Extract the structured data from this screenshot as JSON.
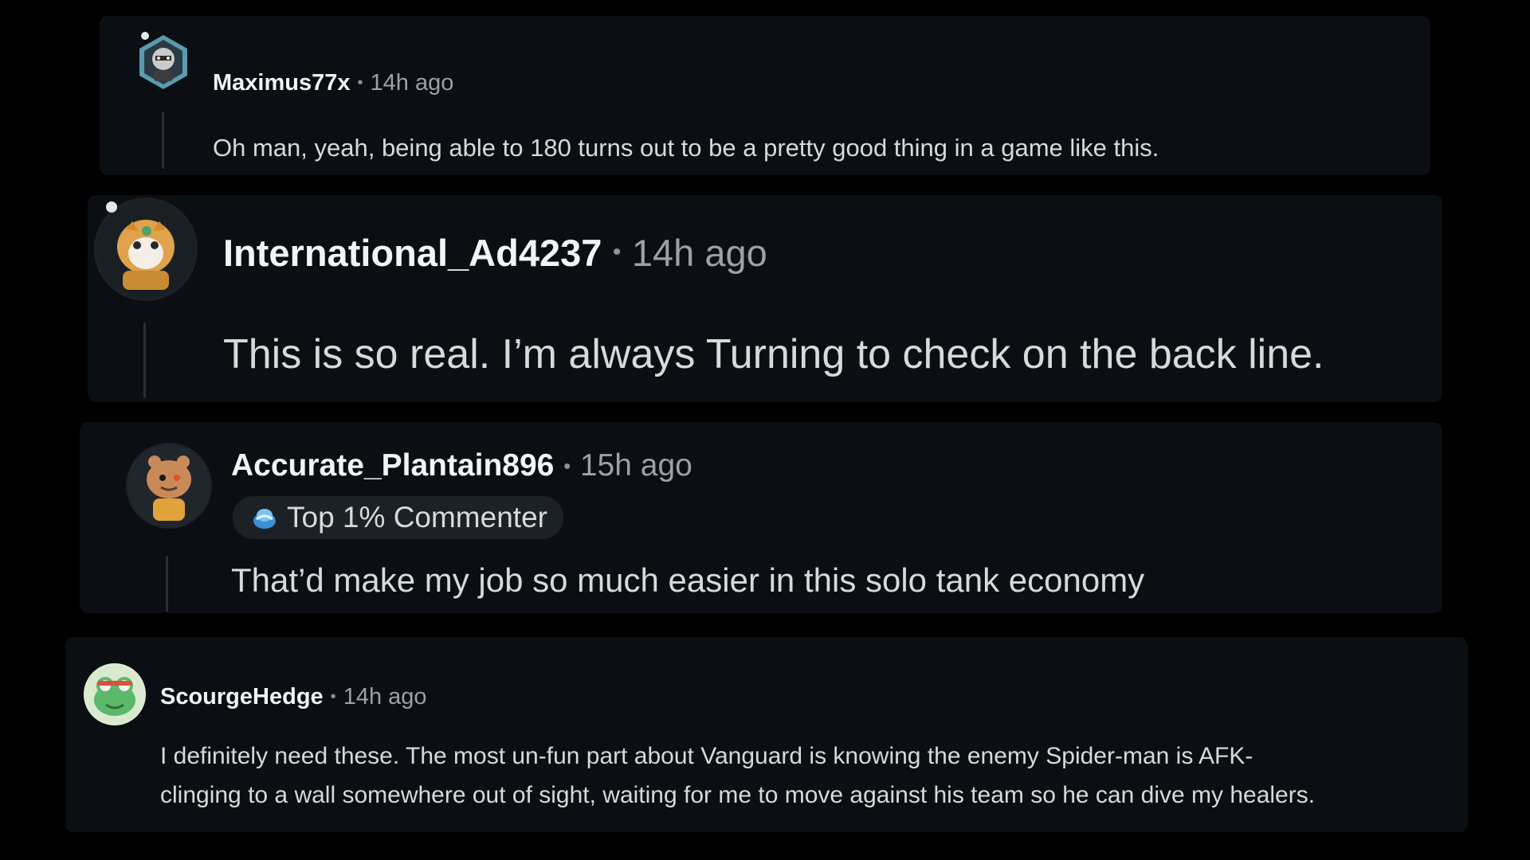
{
  "comments": [
    {
      "username": "Maximus77x",
      "separator": "•",
      "time": "14h ago",
      "body": "Oh man, yeah, being able to 180 turns out to be a pretty good thing in a game like this.",
      "avatar_icon": "robot-avatar-icon"
    },
    {
      "username": "International_Ad4237",
      "separator": "•",
      "time": "14h ago",
      "body": "This is so real. I’m always Turning to check on the back line.",
      "avatar_icon": "tiger-avatar-icon"
    },
    {
      "username": "Accurate_Plantain896",
      "separator": "•",
      "time": "15h ago",
      "badge": "Top 1% Commenter",
      "badge_icon": "top-commenter-icon",
      "body": "That’d make my job so much easier in this solo tank economy",
      "avatar_icon": "snoo-avatar-icon"
    },
    {
      "username": "ScourgeHedge",
      "separator": "•",
      "time": "14h ago",
      "body_lines": [
        "I definitely need these. The most un-fun part about Vanguard is knowing the enemy Spider-man is AFK-",
        "clinging to a wall somewhere out of sight, waiting for me to move against his team so he can dive my healers."
      ],
      "avatar_icon": "frog-avatar-icon"
    }
  ],
  "colors": {
    "background": "#000000",
    "panel": "#0b0e12",
    "text": "#d7dadc",
    "username": "#f1f3f5",
    "muted": "#9aa1a8",
    "badge_bg": "#1c2126"
  }
}
